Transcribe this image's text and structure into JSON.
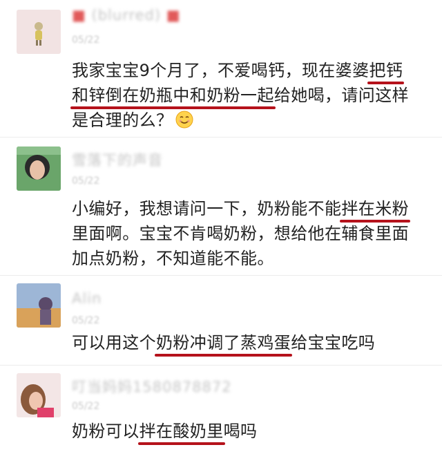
{
  "comments": [
    {
      "username": "(blurred)",
      "date": "05/22",
      "lines": [
        [
          "我家宝宝9个月了，不爱喝钙，现在婆婆",
          "把钙"
        ],
        [
          "和锌倒在奶瓶中和奶粉一起",
          "给她喝，请问这样"
        ],
        [
          "是合理的么？"
        ]
      ]
    },
    {
      "username": "雪落下的声音",
      "date": "05/22",
      "lines": [
        [
          "小编好，我想请问一下，奶粉能不能",
          "拌在米粉"
        ],
        [
          "里面啊。宝宝不肯喝奶粉，想给他在辅食里面"
        ],
        [
          "加点奶粉，不知道能不能。"
        ]
      ]
    },
    {
      "username": "Alin",
      "date": "05/22",
      "lines": [
        [
          "可以用这个",
          "奶粉冲调了蒸鸡蛋",
          "给宝宝吃吗"
        ]
      ]
    },
    {
      "username": "叮当妈妈1580878872",
      "date": "05/22",
      "lines": [
        [
          "奶粉可以",
          "拌在酸奶里",
          "喝吗"
        ]
      ]
    }
  ],
  "emoji_icon": "smiling-face-icon",
  "colors": {
    "underline": "#b5121b",
    "text": "#222222",
    "muted": "#c4c4c4"
  }
}
